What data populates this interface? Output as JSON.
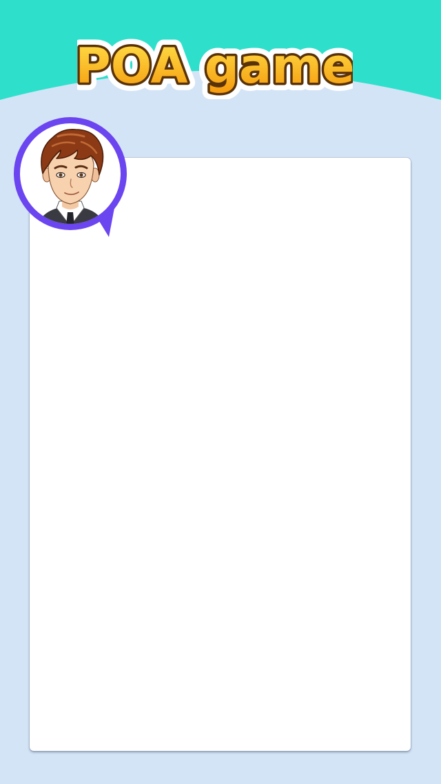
{
  "app": {
    "title": "POA game"
  },
  "colors": {
    "header": "#2ee0cb",
    "background": "#d4e4f7",
    "logo_fill_top": "#ffe14a",
    "logo_fill_bottom": "#f59a0c",
    "logo_outline": "#5a3208",
    "avatar_ring": "#6a45f0",
    "card": "#ffffff"
  },
  "avatar": {
    "icon": "character-portrait-icon"
  }
}
